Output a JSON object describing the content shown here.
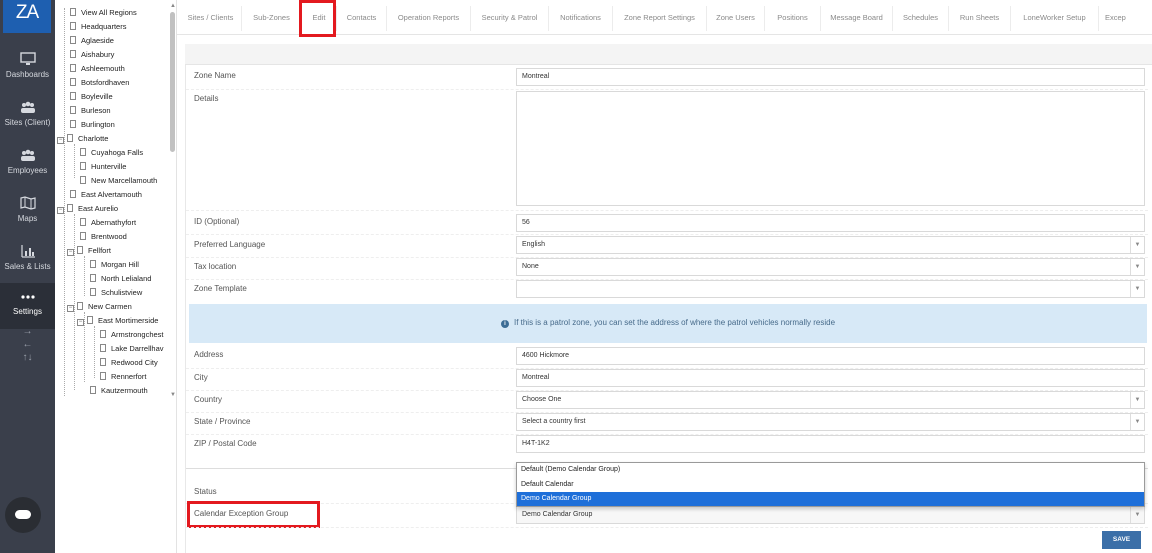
{
  "app": {
    "logo": "ZA"
  },
  "nav": [
    {
      "label": "Dashboards",
      "icon": "monitor-icon"
    },
    {
      "label": "Sites (Client)",
      "icon": "people-group-icon"
    },
    {
      "label": "Employees",
      "icon": "employees-icon"
    },
    {
      "label": "Maps",
      "icon": "map-icon"
    },
    {
      "label": "Sales & Lists",
      "icon": "bar-chart-icon"
    },
    {
      "label": "Settings",
      "icon": "more-dots-icon"
    }
  ],
  "nav_arrows": [
    "→",
    "←",
    "↑↓"
  ],
  "tree": [
    "View All Regions",
    "Headquarters",
    "Aglaeside",
    "Aishabury",
    "Ashleemouth",
    "Botsfordhaven",
    "Boyleville",
    "Burleson",
    "Burlington",
    "Charlotte",
    "Cuyahoga Falls",
    "Hunterville",
    "New Marcellamouth",
    "East Alvertamouth",
    "East Aurelio",
    "Abernathyfort",
    "Brentwood",
    "Fellfort",
    "Morgan Hill",
    "North Lelialand",
    "Schulistview",
    "New Carmen",
    "East Mortimerside",
    "Armstrongchest",
    "Lake Darrellhav",
    "Redwood City",
    "Rennerfort",
    "Kautzermouth"
  ],
  "tabs": [
    "Sites / Clients",
    "Sub-Zones",
    "Edit",
    "Contacts",
    "Operation Reports",
    "Security & Patrol",
    "Notifications",
    "Zone Report Settings",
    "Zone Users",
    "Positions",
    "Message Board",
    "Schedules",
    "Run Sheets",
    "LoneWorker Setup",
    "Excep"
  ],
  "form": {
    "zone_name": {
      "label": "Zone Name",
      "value": "Montreal"
    },
    "details": {
      "label": "Details",
      "value": ""
    },
    "id": {
      "label": "ID (Optional)",
      "value": "56"
    },
    "language": {
      "label": "Preferred Language",
      "value": "English"
    },
    "tax": {
      "label": "Tax location",
      "value": "None"
    },
    "template": {
      "label": "Zone Template",
      "value": ""
    },
    "info": "If this is a patrol zone, you can set the address of where the patrol vehicles normally reside",
    "address": {
      "label": "Address",
      "value": "4600 Hickmore"
    },
    "city": {
      "label": "City",
      "value": "Montreal"
    },
    "country": {
      "label": "Country",
      "value": "Choose One"
    },
    "state": {
      "label": "State / Province",
      "value": "Select a country first"
    },
    "zip": {
      "label": "ZIP / Postal Code",
      "value": "H4T-1K2"
    },
    "status": {
      "label": "Status"
    },
    "calendar": {
      "label": "Calendar Exception Group",
      "value": "Demo Calendar Group"
    },
    "calendar_options": [
      "Default (Demo Calendar Group)",
      "Default Calendar",
      "Demo Calendar Group"
    ],
    "save_label": "SAVE"
  },
  "colors": {
    "highlight": "#e3191f",
    "nav_bg": "#3a3f4b",
    "selected_option": "#1e6fd9",
    "save_btn": "#3b6fa8"
  }
}
